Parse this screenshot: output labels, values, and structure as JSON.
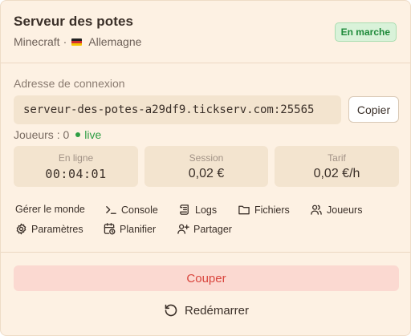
{
  "server": {
    "name": "Serveur des potes",
    "game": "Minecraft",
    "separator": "·",
    "region": "Allemagne",
    "status": "En marche"
  },
  "connection": {
    "label": "Adresse de connexion",
    "address": "serveur-des-potes-a29df9.tickserv.com:25565",
    "copy_label": "Copier"
  },
  "players": {
    "text": "Joueurs : 0",
    "live_label": "live"
  },
  "stats": [
    {
      "label": "En ligne",
      "value": "00:04:01"
    },
    {
      "label": "Session",
      "value": "0,02 €"
    },
    {
      "label": "Tarif",
      "value": "0,02 €/h"
    }
  ],
  "actions": {
    "manage_world": "Gérer le monde",
    "console": "Console",
    "logs": "Logs",
    "files": "Fichiers",
    "players": "Joueurs",
    "settings": "Paramètres",
    "schedule": "Planifier",
    "share": "Partager"
  },
  "footer": {
    "cut_label": "Couper",
    "restart_label": "Redémarrer"
  },
  "colors": {
    "background": "#fdf1e3",
    "status_green": "#1e8a3a",
    "danger_red": "#d9453d"
  }
}
